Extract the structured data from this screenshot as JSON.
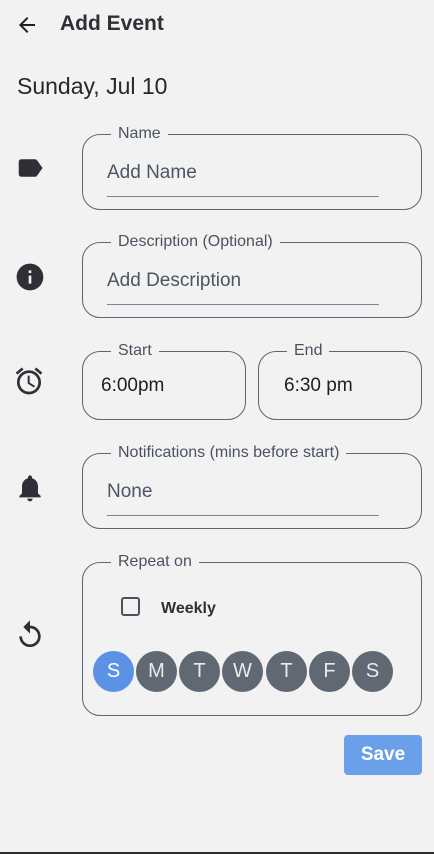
{
  "header": {
    "title": "Add Event",
    "back_icon": "arrow-left-icon"
  },
  "date_label": "Sunday, Jul 10",
  "fields": {
    "name": {
      "label": "Name",
      "placeholder": "Add Name",
      "icon": "label-tag-icon"
    },
    "description": {
      "label": "Description (Optional)",
      "placeholder": "Add Description",
      "icon": "info-icon"
    },
    "start": {
      "label": "Start",
      "value": "6:00pm"
    },
    "end": {
      "label": "End",
      "value": "6:30 pm"
    },
    "time_icon": "alarm-clock-icon",
    "notifications": {
      "label": "Notifications (mins before start)",
      "value": "None",
      "icon": "bell-icon"
    },
    "repeat": {
      "label": "Repeat on",
      "icon": "repeat-icon",
      "weekly_label": "Weekly",
      "weekly_checked": false,
      "days": [
        {
          "letter": "S",
          "selected": true
        },
        {
          "letter": "M",
          "selected": false
        },
        {
          "letter": "T",
          "selected": false
        },
        {
          "letter": "W",
          "selected": false
        },
        {
          "letter": "T",
          "selected": false
        },
        {
          "letter": "F",
          "selected": false
        },
        {
          "letter": "S",
          "selected": false
        }
      ]
    }
  },
  "save_label": "Save",
  "colors": {
    "background": "#f2f2f2",
    "selected_day": "#5b92e5",
    "unselected_day": "#5f6873",
    "save_button": "#6aa0ea"
  }
}
